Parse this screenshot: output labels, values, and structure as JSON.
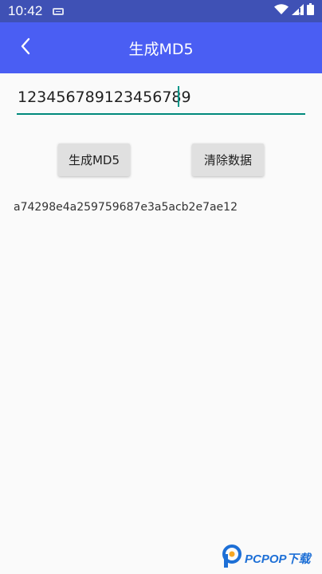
{
  "status_bar": {
    "time": "10:42",
    "icons": [
      "notification-icon",
      "wifi-icon",
      "cell-signal-icon",
      "battery-icon"
    ]
  },
  "app_bar": {
    "title": "生成MD5",
    "back_icon": "chevron-left-icon"
  },
  "input": {
    "value": "123456789123456789",
    "placeholder": ""
  },
  "buttons": {
    "generate_label": "生成MD5",
    "clear_label": "清除数据"
  },
  "result": {
    "hash": "a74298e4a259759687e3a5acb2e7ae12"
  },
  "watermark": {
    "text": "PCPOP下载"
  },
  "colors": {
    "status_bar": "#3f51b5",
    "app_bar": "#4a5ef3",
    "accent": "#00897b",
    "background": "#fafafa",
    "button": "#e0e0e0"
  }
}
